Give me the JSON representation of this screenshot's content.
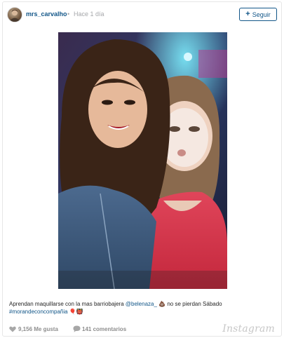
{
  "header": {
    "username": "mrs_carvalho",
    "separator": "•",
    "time_ago": "Hace 1 día",
    "follow_label": "Seguir",
    "follow_icon": "plus-icon"
  },
  "post": {
    "photo_icon": "selfie-photo"
  },
  "caption": {
    "text_before": "Aprendan maquillarse con la mas barriobajera ",
    "mention": "@belenaza_",
    "text_middle": " 💩 no se pierdan Sábado",
    "hashtag": "#morandeconcompañia",
    "emoji_tail": " 🎈👹"
  },
  "footer": {
    "likes_label": "9,156 Me gusta",
    "comments_label": "141 comentarios",
    "logo_text": "Instagram"
  },
  "colors": {
    "link_blue": "#125688",
    "muted": "#a5a7aa",
    "card_border": "#e6e6e6"
  }
}
